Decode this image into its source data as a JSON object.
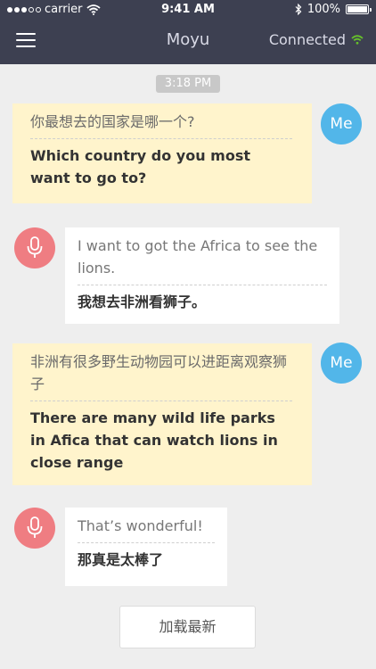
{
  "status_bar": {
    "carrier": "carrier",
    "time": "9:41 AM",
    "battery": "100%",
    "battery_level": 1.0,
    "signal_bars_filled": 3,
    "signal_bars_total": 5
  },
  "nav": {
    "title": "Moyu",
    "connection_status": "Connected",
    "connection_color": "#66c02b"
  },
  "chat": {
    "timestamp": "3:18 PM",
    "messages": [
      {
        "sender": "me",
        "avatar_label": "Me",
        "original": "你最想去的国家是哪一个?",
        "translation": "Which country do you most want to go to?"
      },
      {
        "sender": "other",
        "avatar_icon": "microphone-icon",
        "original": "I want to got the Africa to see the lions.",
        "translation": "我想去非洲看狮子。"
      },
      {
        "sender": "me",
        "avatar_label": "Me",
        "original": "非洲有很多野生动物园可以进距离观察狮子",
        "translation": "There are many wild life parks in Afica that can watch lions in close range"
      },
      {
        "sender": "other",
        "avatar_icon": "microphone-icon",
        "original": "That’s wonderful!",
        "translation": "那真是太棒了"
      }
    ]
  },
  "load_more_label": "加载最新",
  "colors": {
    "header_bg": "#3d4051",
    "me_bubble": "#fff4cc",
    "me_avatar": "#52b6e9",
    "mic_avatar": "#ef7d82"
  }
}
